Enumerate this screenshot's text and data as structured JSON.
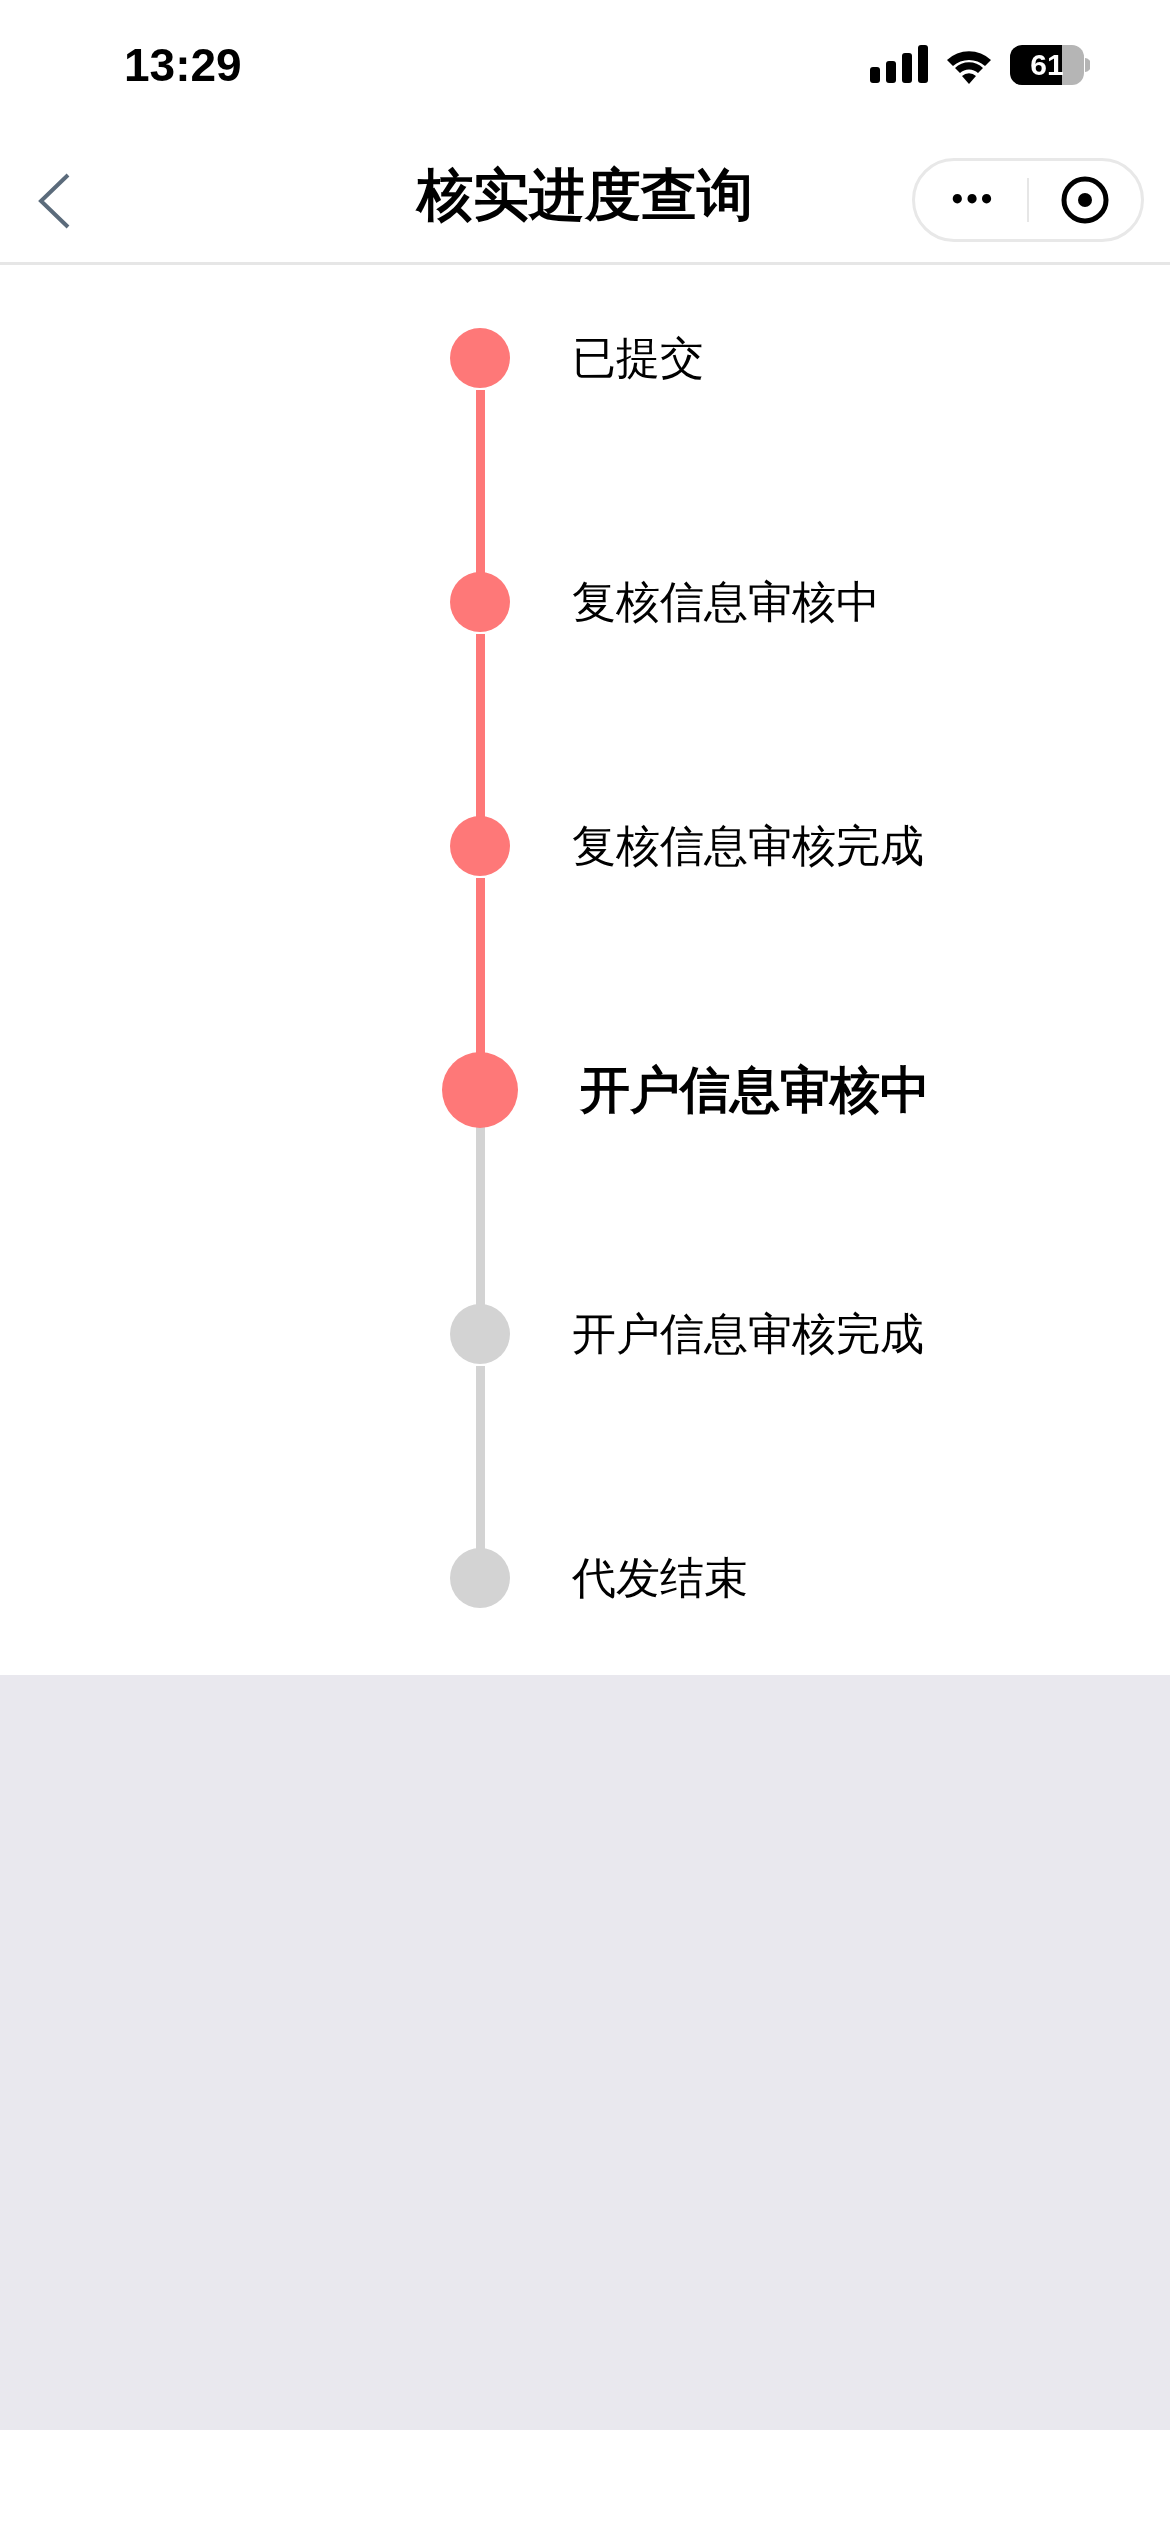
{
  "status_bar": {
    "time": "13:29",
    "battery": "61"
  },
  "nav_bar": {
    "title": "核实进度查询",
    "menu": "•••"
  },
  "steps": [
    {
      "label": "已提交",
      "kind": "done"
    },
    {
      "label": "复核信息审核中",
      "kind": "done"
    },
    {
      "label": "复核信息审核完成",
      "kind": "done"
    },
    {
      "label": "开户信息审核中",
      "kind": "current"
    },
    {
      "label": "开户信息审核完成",
      "kind": "pending"
    },
    {
      "label": "代发结束",
      "kind": "pending"
    }
  ]
}
